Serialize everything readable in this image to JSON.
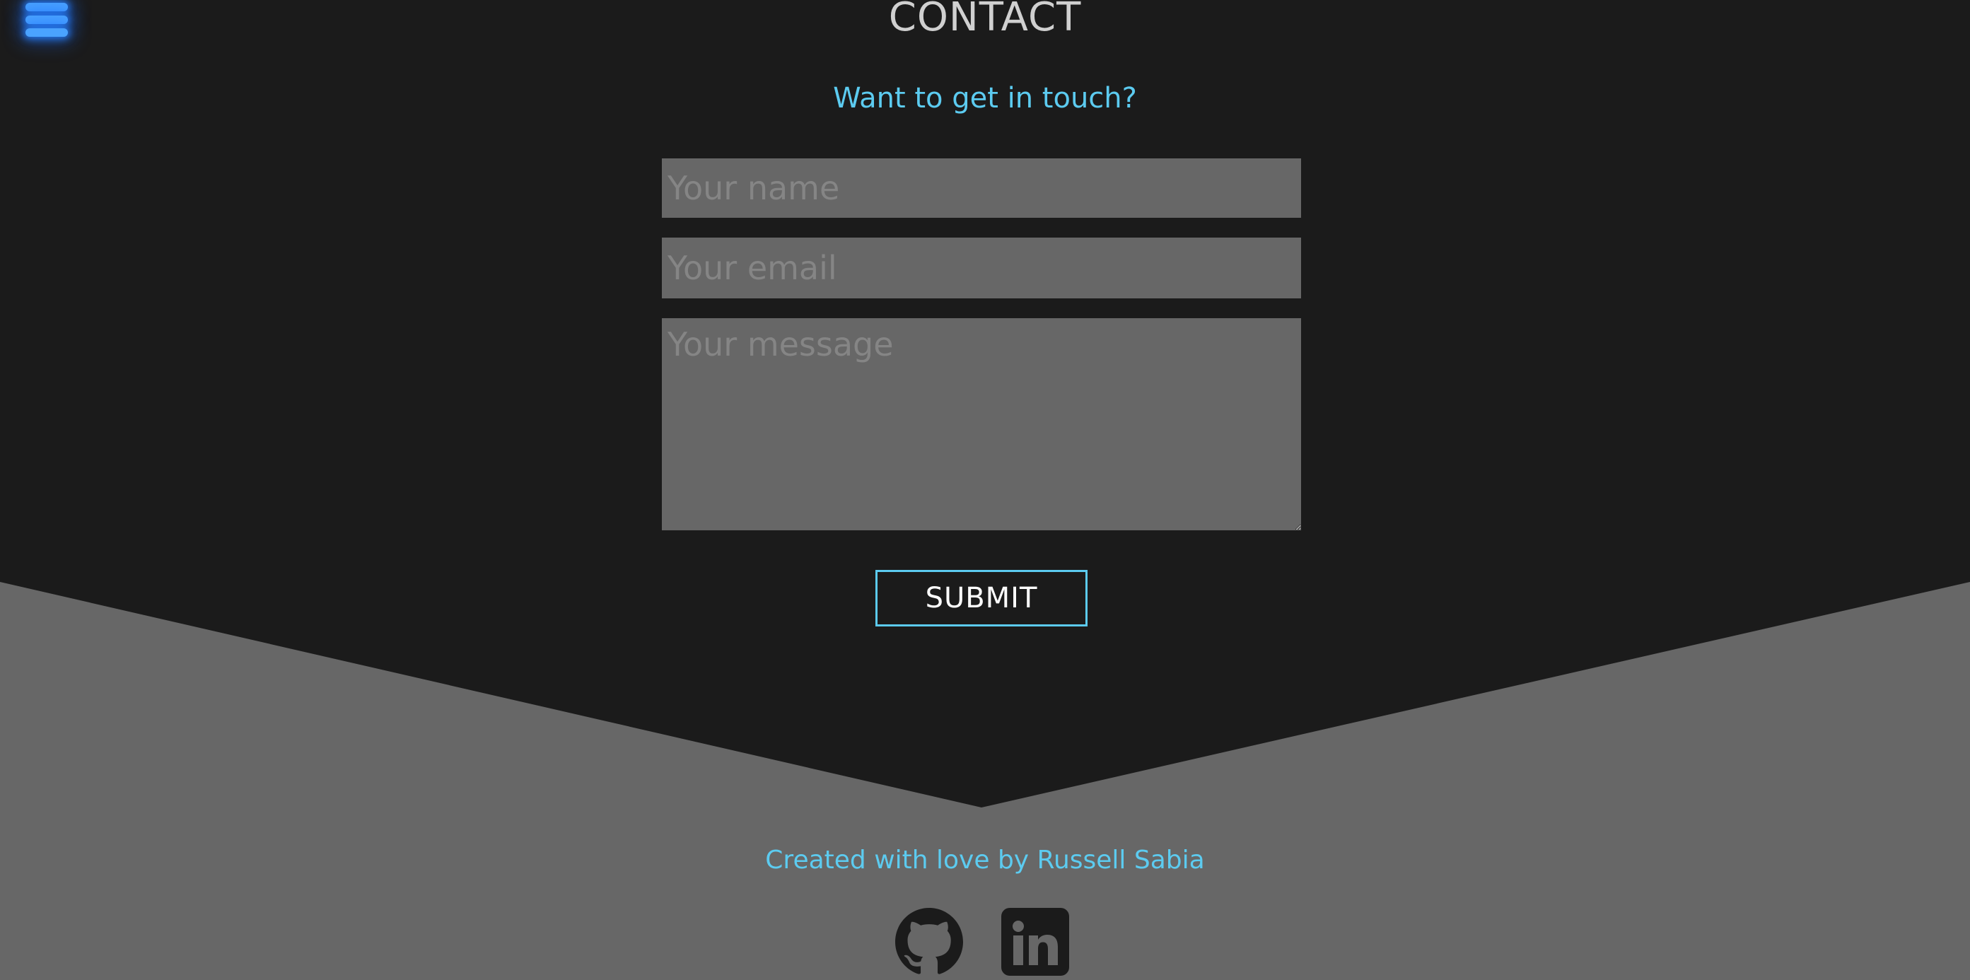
{
  "header": {
    "menu_icon": "hamburger-menu-icon",
    "title": "CONTACT",
    "subtitle": "Want to get in touch?"
  },
  "form": {
    "name_placeholder": "Your name",
    "email_placeholder": "Your email",
    "message_placeholder": "Your message",
    "submit_label": "SUBMIT"
  },
  "footer": {
    "credit": "Created with love by Russell Sabia",
    "social_icons": [
      "github-icon",
      "linkedin-icon"
    ]
  },
  "colors": {
    "background": "#1b1b1b",
    "footer_background": "#676767",
    "accent": "#5ccbf0",
    "menu_glow": "#4aa3ff"
  }
}
